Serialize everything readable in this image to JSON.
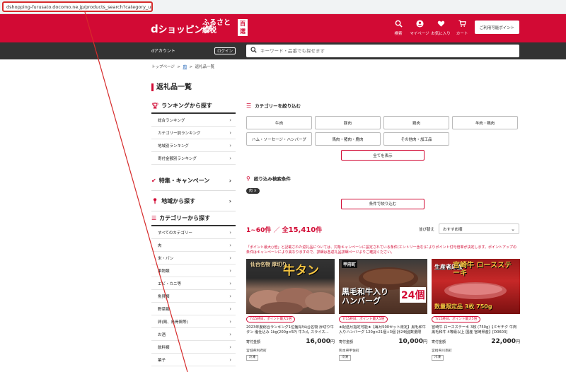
{
  "browser": {
    "url": "dshopping-furusato.docomo.ne.jp/products_search?category_uri=100"
  },
  "header": {
    "logo_d": "d",
    "logo_text": "ショッピング",
    "furusato_line1": "ふるさと",
    "furusato_line2": "納税",
    "hyakusen": "百選",
    "nav": [
      {
        "label": "検索",
        "icon": "search-icon"
      },
      {
        "label": "マイページ",
        "icon": "user-icon"
      },
      {
        "label": "お気に入り",
        "icon": "heart-icon"
      },
      {
        "label": "カート",
        "icon": "cart-icon"
      }
    ],
    "point_button": "ご利用可能ポイント"
  },
  "subheader": {
    "daccount": "dアカウント",
    "login": "ログイン",
    "search_placeholder": "キーワード・品番でも探せます"
  },
  "breadcrumb": {
    "top": "トップページ",
    "sep": ">",
    "meat": "肉",
    "current": "返礼品一覧"
  },
  "page_title": "返礼品一覧",
  "sidebar": {
    "ranking_title": "ランキングから探す",
    "ranking_items": [
      "総合ランキング",
      "カテゴリー別ランキング",
      "地域別ランキング",
      "寄付金額別ランキング"
    ],
    "campaign_title": "特集・キャンペーン",
    "region_title": "地域から探す",
    "category_title": "カテゴリーから探す",
    "category_items": [
      "すべてのカテゴリー",
      "肉",
      "米・パン",
      "果物類",
      "エビ・カニ等",
      "魚貝類",
      "野菜類",
      "卵(鶏、鳥骨鶏等)",
      "お酒",
      "飲料類",
      "菓子"
    ]
  },
  "filter": {
    "title": "カテゴリーを絞り込む",
    "categories": [
      "牛肉",
      "豚肉",
      "鶏肉",
      "羊肉・鴨肉",
      "ハム・ソーセージ・ハンバーグ",
      "馬肉・猪肉・鹿肉",
      "その他肉・加工品"
    ],
    "show_all": "全てを表示",
    "conditions_title": "絞り込み検索条件",
    "chip": "肉 ×",
    "conditions_button": "条件で絞り込む"
  },
  "results": {
    "range": "1~60件",
    "sep": "／",
    "total_prefix": "全",
    "total": "15,410",
    "total_suffix": "件",
    "sort_label": "並び替え",
    "sort_value": "おすすめ順",
    "notice": "「ポイント最大○倍」と記載された返礼品については、対象キャンペーンに設定されている条件(エントリー含む)によりポイント付与倍率が決定します。ポイントアップの条件はキャンペーンにより異なりますので、詳細は各返礼品詳細ページよりご確認ください。"
  },
  "products": [
    {
      "image_text_main": "牛タン",
      "image_text_sub": "仙台名物 厚切り",
      "badge": "7/15終日、ポイント最大5倍",
      "title": "2023年度総合ランキング1位獲得!仙台名物 厚切り牛タン 塩仕込み 1kg(200g×5P) 牛たん スライス…",
      "price_label": "寄付金額",
      "price": "16,000",
      "yen": "円",
      "municipality": "宮城県利府町",
      "tag": "冷凍"
    },
    {
      "image_text_main": "黒毛和牛入り ハンバーグ",
      "image_text_sub": "甲府町",
      "image_text_count": "24個",
      "badge": "7/15終日、ポイント最大5倍",
      "title": "★配送月指定可能★【毎月500セット限定】黒毛和牛入りハンバーグ 120g×21個+3個 計24個[数量限定…",
      "price_label": "寄付金額",
      "price": "10,000",
      "yen": "円",
      "municipality": "熊本県甲佐町",
      "tag": "冷凍"
    },
    {
      "image_text_main": "宮崎牛 ロースステーキ",
      "image_text_sub": "生産者応援",
      "image_text_count": "数量限定品 3枚 750g",
      "badge": "7/15終日、ポイント最大5倍",
      "title": "宮崎牛 ロースステーキ 3枚 (750g)【ミヤチク 牛肉 黒毛和牛 4等級以上 国産 宮崎県産】[D0603]",
      "price_label": "寄付金額",
      "price": "22,000",
      "yen": "円",
      "municipality": "宮崎県川南町",
      "tag": "冷凍"
    }
  ],
  "colors": {
    "brand_red": "#d20a34",
    "dark_bar": "#333333",
    "annotation": "#d62b2b"
  }
}
